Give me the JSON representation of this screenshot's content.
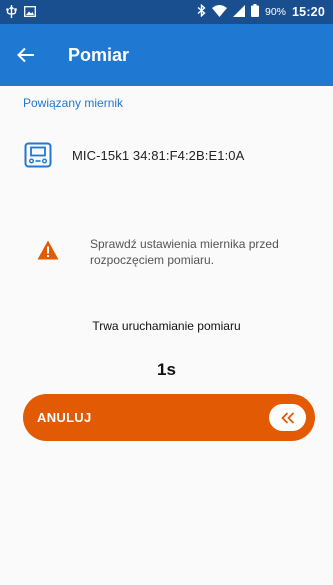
{
  "status_bar": {
    "battery": "90%",
    "time": "15:20",
    "icons": [
      "usb-icon",
      "image-icon",
      "bluetooth-icon",
      "wifi-icon",
      "signal-icon",
      "battery-icon"
    ]
  },
  "app_bar": {
    "title": "Pomiar",
    "back_icon": "arrow-left-icon"
  },
  "section": {
    "label": "Powiązany miernik"
  },
  "device": {
    "name": "MIC-15k1 34:81:F4:2B:E1:0A",
    "icon": "meter-device-icon"
  },
  "warning": {
    "text": "Sprawdź ustawienia miernika przed rozpoczęciem pomiaru.",
    "icon": "warning-triangle-icon"
  },
  "progress": {
    "label": "Trwa uruchamianie pomiaru",
    "timer": "1s"
  },
  "cancel": {
    "label": "ANULUJ",
    "handle_icon": "double-chevron-left-icon"
  },
  "colors": {
    "status_bar": "#1a4f8f",
    "app_bar": "#1f78d1",
    "accent": "#e25a04",
    "section_label": "#1f78d1"
  }
}
